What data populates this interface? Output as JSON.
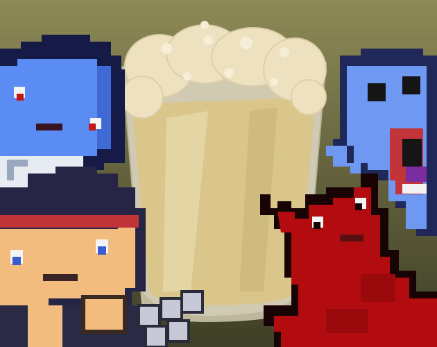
{
  "scene": {
    "background_top": "#8e8a57",
    "background_bottom": "#3f3f27"
  },
  "characters": [
    {
      "name": "blue-blob-character",
      "color": "#5b8cf4",
      "outline": "#151b46"
    },
    {
      "name": "human-character",
      "color": "#f2bc7f",
      "hair": "#262545",
      "headband": "#c0343a"
    },
    {
      "name": "blue-ghost-character",
      "color": "#6f98f2",
      "outline": "#1f2858"
    },
    {
      "name": "red-devil-character",
      "color": "#b20c10",
      "outline": "#180404"
    }
  ],
  "mug": {
    "beer": "#dcc684",
    "foam": "#eee1bf",
    "glass": "#cfcab1"
  }
}
